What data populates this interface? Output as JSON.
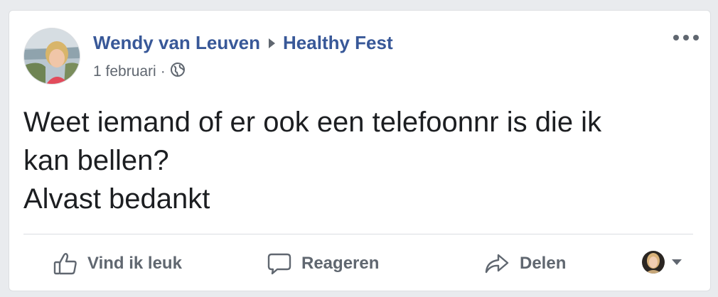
{
  "post": {
    "author": "Wendy van Leuven",
    "group": "Healthy Fest",
    "date": "1 februari",
    "separator": "·",
    "privacy_icon": "globe-icon",
    "text_lines": [
      "Weet iemand of er ook een telefoonnr is die ik",
      "kan bellen?",
      "Alvast bedankt"
    ]
  },
  "actions": {
    "like_label": "Vind ik leuk",
    "comment_label": "Reageren",
    "share_label": "Delen"
  },
  "colors": {
    "link": "#385898",
    "secondary_text": "#606770",
    "body_text": "#1c1e21",
    "background": "#e9ebee"
  }
}
